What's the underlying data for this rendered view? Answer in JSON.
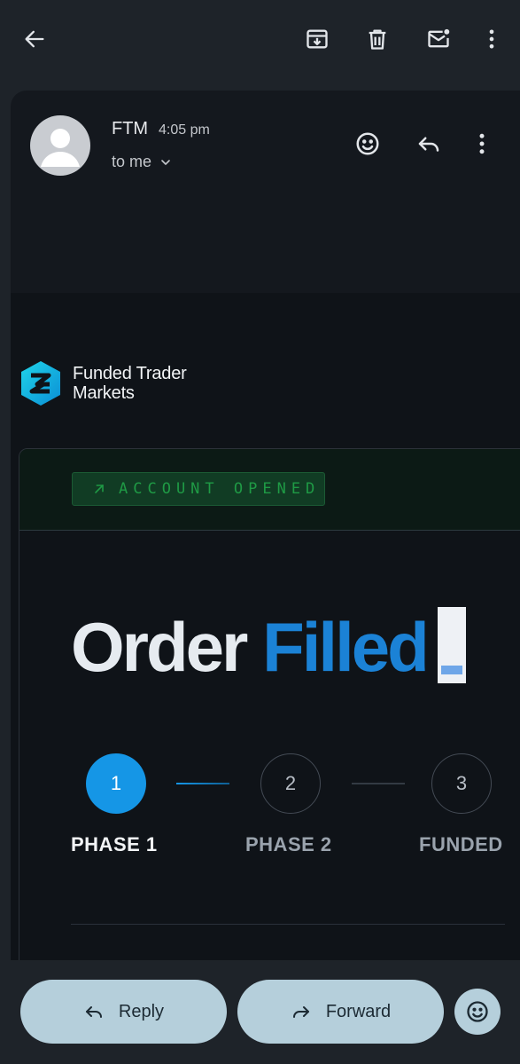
{
  "email": {
    "sender": "FTM",
    "time": "4:05 pm",
    "recipient_label": "to me"
  },
  "brand": {
    "name_line1": "Funded Trader",
    "name_line2": "Markets"
  },
  "badge": {
    "label": "ACCOUNT OPENED"
  },
  "headline": {
    "word1": "Order",
    "word2": "Filled"
  },
  "steps": [
    {
      "number": "1",
      "label": "PHASE 1",
      "state": "active"
    },
    {
      "number": "2",
      "label": "PHASE 2",
      "state": "pending"
    },
    {
      "number": "3",
      "label": "FUNDED",
      "state": "pending"
    }
  ],
  "actions": {
    "reply_label": "Reply",
    "forward_label": "Forward"
  },
  "colors": {
    "accent": "#1596e6",
    "headline_highlight": "#1b82d6",
    "badge_text": "#1f9a45",
    "pill_bg": "#b5cfdb"
  },
  "icons": [
    "back-arrow-icon",
    "archive-icon",
    "trash-icon",
    "mark-unread-icon",
    "more-vert-icon",
    "emoji-icon",
    "reply-icon",
    "forward-icon",
    "chevron-down-icon"
  ]
}
